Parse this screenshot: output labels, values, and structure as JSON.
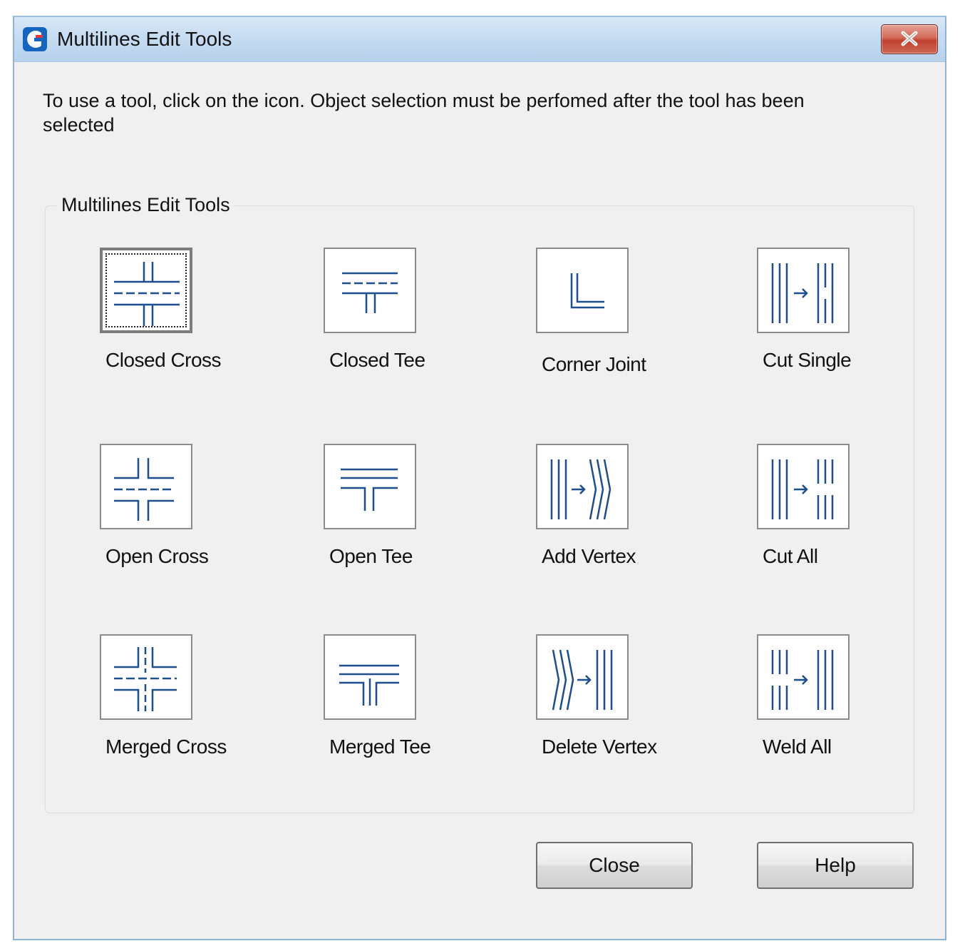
{
  "window": {
    "title": "Multilines Edit Tools",
    "close_glyph": "✕"
  },
  "instructions": "To use a tool, click on the icon. Object selection must be perfomed after the tool has been selected",
  "group": {
    "legend": "Multilines Edit Tools",
    "tools": [
      {
        "label": "Closed Cross",
        "icon": "closed-cross-icon",
        "selected": true
      },
      {
        "label": "Closed Tee",
        "icon": "closed-tee-icon"
      },
      {
        "label": "Corner Joint",
        "icon": "corner-joint-icon"
      },
      {
        "label": "Cut Single",
        "icon": "cut-single-icon"
      },
      {
        "label": "Open Cross",
        "icon": "open-cross-icon"
      },
      {
        "label": "Open Tee",
        "icon": "open-tee-icon"
      },
      {
        "label": "Add Vertex",
        "icon": "add-vertex-icon"
      },
      {
        "label": "Cut All",
        "icon": "cut-all-icon"
      },
      {
        "label": "Merged Cross",
        "icon": "merged-cross-icon"
      },
      {
        "label": "Merged Tee",
        "icon": "merged-tee-icon"
      },
      {
        "label": "Delete Vertex",
        "icon": "delete-vertex-icon"
      },
      {
        "label": "Weld All",
        "icon": "weld-all-icon"
      }
    ]
  },
  "buttons": {
    "close": "Close",
    "help": "Help"
  },
  "colors": {
    "icon_stroke": "#1f4e8c",
    "titlebar": "#c6dcf2",
    "close_button": "#c9503e"
  }
}
